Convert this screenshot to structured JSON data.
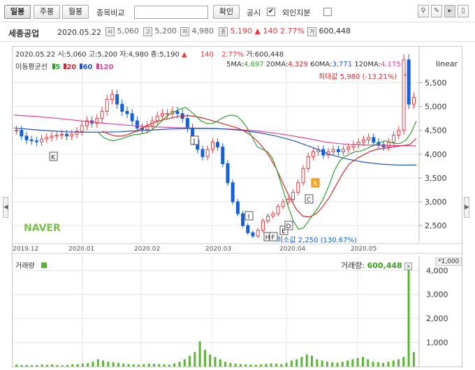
{
  "toolbar": {
    "daily_label": "일봉",
    "weekly_label": "주봉",
    "monthly_label": "월봉",
    "compare_label": "종목비교",
    "compare_input_value": "",
    "confirm_label": "확인",
    "disclosure_label": "공시",
    "disclosure_checked": "✔",
    "foreign_label": "외인지분"
  },
  "info": {
    "name": "세종공업",
    "date": "2020.05.22",
    "open_icon": "시",
    "open": "5,060",
    "high_icon": "고",
    "high": "5,200",
    "low_icon": "저",
    "low": "4,980",
    "close_icon": "종",
    "close": "5,190",
    "change": "▲ 140",
    "rate": "2.77%",
    "volume_icon": "거",
    "volume": "600,448"
  },
  "ohlc_line": {
    "date": "2020.05.22",
    "open": "시:5,060",
    "high": "고:5,200",
    "low": "저:4,980",
    "close": "종:5,190",
    "arrow": "▲",
    "change": "140",
    "rate": "2.77%",
    "volume": "거:600,448"
  },
  "ma_legend": {
    "title": "이동평균선",
    "items": [
      {
        "label": "5",
        "color": "#2ea02e"
      },
      {
        "label": "20",
        "color": "#d42a2a"
      },
      {
        "label": "60",
        "color": "#1f57c3"
      },
      {
        "label": "120",
        "color": "#e0449a"
      }
    ]
  },
  "ma_values": {
    "ma5_label": "5MA:",
    "ma5": "4,697",
    "ma20_label": "20MA:",
    "ma20": "4,329",
    "ma60_label": "60MA:",
    "ma60": "3,771",
    "ma120_label": "120MA:",
    "ma120": "4,175"
  },
  "scale_mode": "linear",
  "max_annotation": "최대값 5,980 (-13.21%)",
  "min_annotation": "최소값 2,250 (130.67%)",
  "logo": "NAVER",
  "volume_panel": {
    "title": "거래량",
    "value_label": "거래량:",
    "value": "600,448",
    "unit": "*1,000",
    "close_icon": "x"
  },
  "colors": {
    "up": "#e8383d",
    "down": "#1560d6",
    "ma5": "#2ea02e",
    "ma20": "#d42a2a",
    "ma60": "#1f57c3",
    "ma120": "#e0449a",
    "volume_bar": "#5ab535",
    "grid": "#e6e6e6"
  },
  "chart_data": {
    "type": "candlestick",
    "y_ticks": [
      2500,
      3000,
      3500,
      4000,
      4500,
      5000,
      5500
    ],
    "ylim": [
      2150,
      6050
    ],
    "x_labels": [
      "2019.12",
      "2020.01",
      "2020.02",
      "2020.03",
      "2020.04",
      "2020.05"
    ],
    "event_markers": [
      "K",
      "J",
      "I",
      "H",
      "F",
      "E",
      "D",
      "C",
      "A"
    ],
    "close_series": [
      4500,
      4380,
      4300,
      4280,
      4260,
      4320,
      4350,
      4380,
      4400,
      4420,
      4380,
      4420,
      4480,
      4600,
      4700,
      4650,
      4750,
      4900,
      5150,
      5250,
      5050,
      4900,
      4850,
      4700,
      4550,
      4520,
      4600,
      4700,
      4800,
      4850,
      4850,
      4900,
      4850,
      4750,
      4550,
      4300,
      4100,
      3950,
      4100,
      4250,
      4150,
      3800,
      3400,
      3000,
      2750,
      2500,
      2350,
      2280,
      2400,
      2600,
      2700,
      2750,
      2900,
      3000,
      3050,
      3200,
      3400,
      3700,
      3950,
      4050,
      4100,
      3980,
      4050,
      4100,
      4050,
      4100,
      4150,
      4200,
      4250,
      4300,
      4350,
      4250,
      4200,
      4150,
      4250,
      4400,
      4500,
      5980,
      5050,
      5190
    ],
    "ma5": [
      4450,
      4350,
      4300,
      4280,
      4310,
      4340,
      4380,
      4410,
      4420,
      4440,
      4480,
      4560,
      4660,
      4760,
      4850,
      4900,
      4950,
      4980,
      4900,
      4800,
      4700,
      4650,
      4640,
      4680,
      4750,
      4800,
      4820,
      4800,
      4700,
      4550,
      4350,
      4150,
      4100,
      4050,
      3900,
      3600,
      3250,
      2900,
      2600,
      2420,
      2450,
      2600,
      2750,
      2900,
      3100,
      3350,
      3650,
      3850,
      3950,
      4000,
      4050,
      4060,
      4100,
      4150,
      4200,
      4250,
      4280,
      4250,
      4220,
      4230,
      4300,
      4450,
      4697
    ],
    "ma20": [
      4480,
      4420,
      4380,
      4380,
      4420,
      4480,
      4550,
      4620,
      4680,
      4720,
      4750,
      4780,
      4800,
      4810,
      4790,
      4760,
      4720,
      4680,
      4640,
      4600,
      4560,
      4500,
      4420,
      4300,
      4150,
      3950,
      3700,
      3400,
      3100,
      2850,
      2700,
      2680,
      2750,
      2900,
      3100,
      3350,
      3600,
      3800,
      3900,
      3980,
      4050,
      4100,
      4120,
      4140,
      4160,
      4180,
      4200,
      4329
    ],
    "ma60": [
      4550,
      4520,
      4490,
      4470,
      4460,
      4460,
      4470,
      4490,
      4510,
      4530,
      4540,
      4540,
      4530,
      4500,
      4450,
      4380,
      4280,
      4150,
      4000,
      3900,
      3830,
      3790,
      3770,
      3771
    ],
    "ma120": [
      4820,
      4790,
      4750,
      4700,
      4650,
      4610,
      4580,
      4560,
      4550,
      4540,
      4520,
      4480,
      4420,
      4340,
      4250,
      4200,
      4190,
      4180,
      4175
    ],
    "volume_ticks": [
      1000,
      2000,
      3000,
      4000
    ],
    "volume_ylim": [
      0,
      4300
    ],
    "volume_values": [
      80,
      60,
      70,
      50,
      60,
      80,
      70,
      90,
      60,
      50,
      70,
      90,
      100,
      120,
      140,
      200,
      300,
      250,
      200,
      180,
      150,
      120,
      100,
      90,
      80,
      100,
      120,
      110,
      100,
      90,
      80,
      130,
      200,
      300,
      450,
      600,
      1050,
      700,
      500,
      400,
      300,
      200,
      150,
      120,
      100,
      90,
      80,
      70,
      90,
      110,
      130,
      120,
      100,
      150,
      250,
      300,
      400,
      500,
      450,
      300,
      250,
      200,
      180,
      160,
      200,
      250,
      300,
      350,
      400,
      300,
      200,
      180,
      150,
      200,
      250,
      300,
      400,
      4200,
      600
    ]
  }
}
